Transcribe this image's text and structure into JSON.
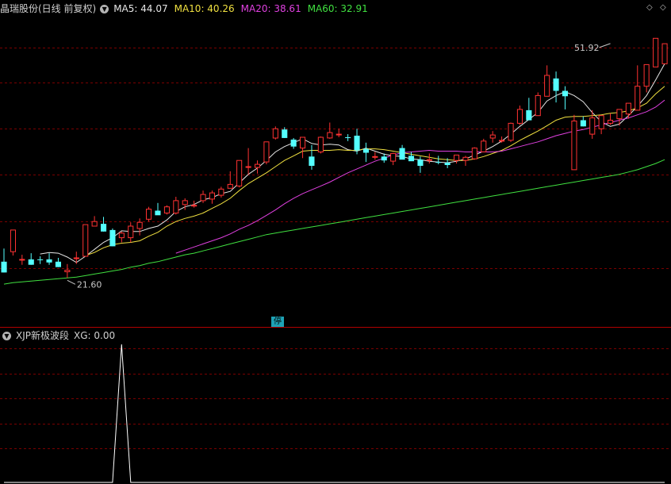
{
  "main_header": {
    "stock_name": "晶瑞股份(日线 前复权)",
    "ma_items": [
      {
        "label": "MA5: 44.07",
        "color": "#e6e6e6"
      },
      {
        "label": "MA10: 40.26",
        "color": "#f0e040"
      },
      {
        "label": "MA20: 38.61",
        "color": "#e040e0"
      },
      {
        "label": "MA60: 32.91",
        "color": "#40e040"
      }
    ]
  },
  "sub_header": {
    "indicator_name": "XJP新极波段",
    "value_label": "XG: 0.00"
  },
  "badge": "停",
  "colors": {
    "up": "#ff3232",
    "down": "#54ffff",
    "grid": "#7a0000",
    "separator": "#b00000"
  },
  "chart_data": [
    {
      "type": "candlestick",
      "title": "晶瑞股份(日线 前复权)",
      "ylim": [
        16.5,
        55.5
      ],
      "annotations": [
        {
          "text": "51.92",
          "bar": 67,
          "price": 51.92
        },
        {
          "text": "21.60",
          "bar": 7,
          "price": 21.6
        }
      ],
      "candles": [
        [
          23.7,
          25.4,
          22.3,
          22.3
        ],
        [
          25.0,
          27.8,
          24.5,
          27.8
        ],
        [
          24.0,
          24.6,
          23.3,
          24.0
        ],
        [
          24.0,
          24.8,
          23.3,
          23.3
        ],
        [
          24.0,
          24.4,
          23.4,
          23.9
        ],
        [
          24.0,
          24.8,
          23.3,
          23.6
        ],
        [
          23.7,
          24.2,
          23.0,
          23.0
        ],
        [
          22.4,
          23.4,
          21.6,
          22.6
        ],
        [
          24.2,
          25.0,
          23.4,
          24.2
        ],
        [
          24.4,
          28.5,
          24.4,
          28.5
        ],
        [
          28.3,
          29.6,
          28.3,
          28.9
        ],
        [
          28.6,
          29.5,
          27.6,
          27.6
        ],
        [
          27.8,
          28.0,
          25.7,
          25.7
        ],
        [
          26.8,
          27.6,
          26.2,
          27.4
        ],
        [
          26.8,
          28.8,
          26.2,
          28.3
        ],
        [
          28.0,
          29.3,
          27.1,
          28.8
        ],
        [
          29.2,
          30.8,
          28.9,
          30.5
        ],
        [
          30.3,
          31.3,
          29.8,
          29.7
        ],
        [
          30.0,
          31.0,
          29.8,
          30.8
        ],
        [
          30.0,
          32.1,
          29.8,
          31.6
        ],
        [
          31.1,
          31.9,
          30.4,
          31.6
        ],
        [
          31.0,
          31.6,
          30.7,
          31.0
        ],
        [
          31.6,
          32.9,
          31.3,
          32.4
        ],
        [
          31.8,
          32.9,
          31.2,
          32.6
        ],
        [
          32.3,
          33.4,
          32.0,
          33.1
        ],
        [
          33.2,
          35.4,
          33.2,
          33.7
        ],
        [
          33.5,
          36.8,
          33.3,
          36.8
        ],
        [
          36.0,
          38.4,
          35.0,
          36.0
        ],
        [
          35.9,
          36.8,
          35.1,
          36.3
        ],
        [
          36.6,
          39.2,
          36.3,
          39.2
        ],
        [
          39.7,
          41.2,
          39.5,
          40.9
        ],
        [
          40.8,
          41.1,
          39.7,
          39.7
        ],
        [
          39.5,
          39.7,
          38.3,
          38.6
        ],
        [
          38.4,
          39.8,
          37.1,
          39.8
        ],
        [
          37.3,
          38.8,
          35.6,
          36.1
        ],
        [
          37.9,
          39.9,
          37.7,
          39.8
        ],
        [
          39.7,
          41.7,
          39.6,
          40.4
        ],
        [
          40.2,
          40.9,
          39.8,
          40.2
        ],
        [
          39.8,
          40.2,
          39.3,
          39.7
        ],
        [
          40.0,
          40.9,
          37.6,
          38.1
        ],
        [
          38.3,
          39.1,
          36.6,
          37.8
        ],
        [
          37.3,
          37.9,
          36.9,
          37.3
        ],
        [
          37.3,
          37.7,
          36.5,
          36.8
        ],
        [
          36.7,
          37.8,
          36.2,
          37.7
        ],
        [
          38.4,
          38.8,
          37.2,
          36.9
        ],
        [
          37.4,
          37.9,
          37.2,
          36.7
        ],
        [
          36.9,
          37.3,
          35.2,
          36.1
        ],
        [
          36.8,
          37.7,
          36.4,
          36.9
        ],
        [
          36.6,
          37.4,
          36.3,
          36.5
        ],
        [
          36.5,
          37.1,
          35.8,
          36.2
        ],
        [
          36.8,
          37.5,
          36.4,
          37.5
        ],
        [
          36.8,
          37.4,
          36.1,
          37.2
        ],
        [
          37.0,
          38.5,
          36.9,
          38.4
        ],
        [
          37.9,
          39.6,
          37.9,
          39.3
        ],
        [
          39.7,
          40.6,
          39.1,
          40.1
        ],
        [
          39.4,
          39.9,
          39.1,
          39.4
        ],
        [
          39.4,
          41.7,
          39.2,
          41.6
        ],
        [
          41.6,
          43.9,
          41.4,
          43.4
        ],
        [
          43.3,
          44.9,
          42.6,
          42.0
        ],
        [
          42.6,
          45.6,
          42.6,
          45.2
        ],
        [
          45.1,
          49.1,
          45.1,
          47.8
        ],
        [
          47.4,
          48.3,
          44.3,
          45.8
        ],
        [
          45.8,
          46.4,
          43.4,
          45.1
        ],
        [
          35.6,
          42.7,
          35.6,
          41.9
        ],
        [
          42.0,
          42.5,
          41.2,
          41.2
        ],
        [
          40.2,
          43.3,
          39.6,
          42.3
        ],
        [
          40.9,
          42.6,
          40.2,
          42.6
        ],
        [
          41.6,
          42.9,
          41.4,
          42.0
        ],
        [
          42.2,
          43.4,
          41.3,
          43.4
        ],
        [
          42.8,
          44.2,
          42.2,
          44.2
        ],
        [
          43.3,
          49.1,
          43.3,
          46.4
        ],
        [
          46.4,
          47.5,
          45.6,
          49.2
        ],
        [
          48.9,
          52.6,
          48.9,
          52.6
        ],
        [
          49.3,
          51.9,
          49.3,
          51.9
        ]
      ],
      "ma_series": [
        {
          "name": "MA5",
          "color": "#e6e6e6",
          "values": [
            null,
            null,
            null,
            null,
            24.7,
            24.9,
            24.8,
            24.3,
            23.6,
            24.4,
            25.3,
            26.2,
            26.8,
            27.7,
            27.6,
            27.6,
            28.0,
            28.3,
            29.1,
            30.2,
            30.8,
            31.1,
            31.7,
            32.0,
            32.5,
            32.8,
            33.9,
            35.0,
            35.8,
            36.8,
            37.9,
            38.6,
            39.1,
            39.6,
            39.0,
            38.8,
            38.9,
            38.8,
            38.2,
            38.0,
            38.4,
            38.0,
            37.6,
            37.4,
            37.3,
            37.0,
            36.9,
            36.7,
            36.6,
            36.5,
            36.7,
            37.0,
            37.5,
            38.0,
            38.6,
            39.3,
            40.2,
            41.2,
            42.1,
            43.0,
            44.5,
            45.2,
            45.7,
            45.2,
            44.4,
            43.0,
            41.8,
            41.2,
            41.5,
            42.6,
            43.8,
            45.2,
            47.2,
            49.3
          ]
        },
        {
          "name": "MA10",
          "color": "#f0e040",
          "values": [
            null,
            null,
            null,
            null,
            null,
            null,
            null,
            null,
            null,
            24.5,
            24.9,
            25.5,
            25.9,
            26.1,
            26.2,
            26.4,
            27.0,
            27.5,
            28.3,
            28.9,
            29.3,
            29.6,
            30.0,
            30.6,
            31.2,
            31.9,
            32.9,
            33.8,
            34.5,
            35.2,
            36.0,
            36.8,
            37.4,
            38.0,
            38.1,
            38.1,
            38.1,
            38.2,
            38.1,
            38.1,
            38.3,
            38.3,
            38.2,
            38.0,
            37.8,
            37.6,
            37.4,
            37.2,
            37.0,
            36.9,
            36.8,
            36.8,
            37.0,
            37.3,
            37.7,
            38.1,
            38.7,
            39.4,
            40.0,
            40.6,
            41.3,
            42.0,
            42.4,
            42.5,
            42.5,
            42.6,
            42.7,
            42.9,
            43.0,
            43.2,
            43.6,
            44.2,
            45.4,
            46.4
          ]
        },
        {
          "name": "MA20",
          "color": "#e040e0",
          "values": [
            null,
            null,
            null,
            null,
            null,
            null,
            null,
            null,
            null,
            null,
            null,
            null,
            null,
            null,
            null,
            null,
            null,
            null,
            null,
            24.8,
            25.2,
            25.6,
            26.0,
            26.4,
            26.8,
            27.3,
            27.9,
            28.4,
            29.0,
            29.7,
            30.4,
            31.2,
            31.9,
            32.5,
            33.0,
            33.5,
            34.0,
            34.6,
            35.2,
            35.7,
            36.2,
            36.7,
            37.1,
            37.5,
            37.8,
            37.9,
            38.0,
            38.1,
            38.0,
            38.0,
            38.0,
            37.9,
            37.9,
            37.9,
            37.9,
            38.0,
            38.3,
            38.6,
            38.9,
            39.2,
            39.6,
            40.0,
            40.3,
            40.6,
            40.8,
            41.1,
            41.4,
            41.7,
            42.0,
            42.3,
            42.7,
            43.1,
            43.7,
            44.6
          ]
        },
        {
          "name": "MA60",
          "color": "#40e040",
          "values": [
            20.8,
            21.0,
            21.1,
            21.2,
            21.3,
            21.4,
            21.5,
            21.6,
            21.7,
            21.9,
            22.1,
            22.3,
            22.5,
            22.7,
            23.0,
            23.2,
            23.5,
            23.7,
            24.0,
            24.3,
            24.6,
            24.8,
            25.1,
            25.4,
            25.7,
            26.0,
            26.3,
            26.6,
            26.9,
            27.2,
            27.4,
            27.6,
            27.8,
            28.0,
            28.2,
            28.4,
            28.6,
            28.8,
            29.0,
            29.2,
            29.4,
            29.6,
            29.8,
            30.0,
            30.2,
            30.4,
            30.6,
            30.8,
            31.0,
            31.2,
            31.4,
            31.6,
            31.8,
            32.0,
            32.2,
            32.4,
            32.6,
            32.8,
            33.0,
            33.2,
            33.4,
            33.6,
            33.8,
            34.0,
            34.2,
            34.4,
            34.6,
            34.8,
            35.0,
            35.3,
            35.6,
            36.0,
            36.4,
            36.9
          ]
        }
      ]
    },
    {
      "type": "line",
      "title": "XJP新极波段",
      "series": [
        {
          "name": "XG",
          "values": [
            0,
            0,
            0,
            0,
            0,
            0,
            0,
            0,
            0,
            0,
            0,
            0,
            0,
            1,
            0,
            0,
            0,
            0,
            0,
            0,
            0,
            0,
            0,
            0,
            0,
            0,
            0,
            0,
            0,
            0,
            0,
            0,
            0,
            0,
            0,
            0,
            0,
            0,
            0,
            0,
            0,
            0,
            0,
            0,
            0,
            0,
            0,
            0,
            0,
            0,
            0,
            0,
            0,
            0,
            0,
            0,
            0,
            0,
            0,
            0,
            0,
            0,
            0,
            0,
            0,
            0,
            0,
            0,
            0,
            0,
            0,
            0,
            0,
            0
          ]
        }
      ],
      "ylim": [
        0,
        1
      ]
    }
  ]
}
